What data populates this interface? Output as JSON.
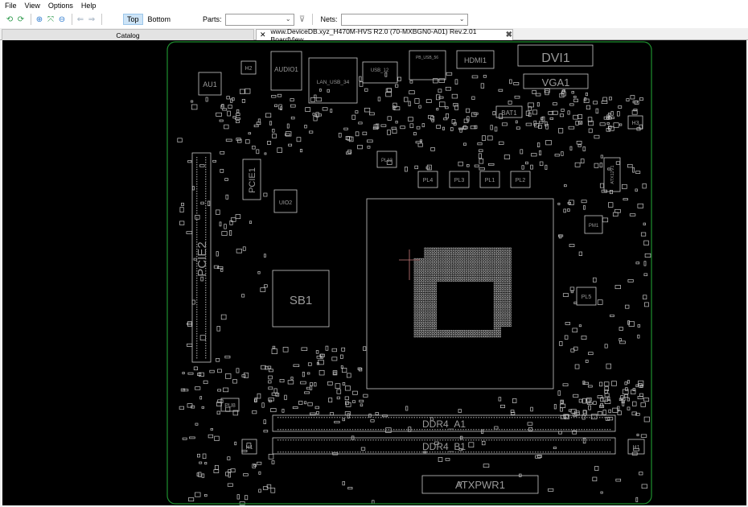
{
  "menu": {
    "items": [
      "File",
      "View",
      "Options",
      "Help"
    ]
  },
  "toolbar": {
    "top_label": "Top",
    "bottom_label": "Bottom",
    "parts_label": "Parts:",
    "parts_value": "",
    "nets_label": "Nets:",
    "nets_value": ""
  },
  "tabs": {
    "catalog": "Catalog",
    "board": "www.DeviceDB.xyz_H470M-HVS R2.0 (70-MXBGN0-A01) Rev.2.01 BoardView"
  },
  "board": {
    "labels": {
      "dvi": "DVI1",
      "vga": "VGA1",
      "hdmi": "HDMI1",
      "audio": "AUDIO1",
      "au": "AU1",
      "h2": "H2",
      "h3": "H3",
      "lan": "LAN_USB_34",
      "usb12": "USB_12",
      "usb56": "PB_USB_56",
      "bat": "BAT1",
      "pcie1": "PCIE1",
      "pcie2": "PCIE2",
      "uio2": "UIO2",
      "pl13": "PL13",
      "pl4": "PL4",
      "pl3": "PL3",
      "pl1": "PL1",
      "pl2": "PL2",
      "pl5": "PL5",
      "pm1": "PM1",
      "sb1": "SB1",
      "ddr_a1": "DDR4_A1",
      "ddr_b1": "DDR4_B1",
      "atxpwr": "ATXPWR1",
      "atx12v": "ATX12V1",
      "pu8": "PU8",
      "h1_left": "H1",
      "h1_right": "H1"
    }
  },
  "colors": {
    "board_outline": "#1f8f2f",
    "silkscreen": "#c8c8c8",
    "canvas_bg": "#000000",
    "cursor": "#c77a7a"
  }
}
